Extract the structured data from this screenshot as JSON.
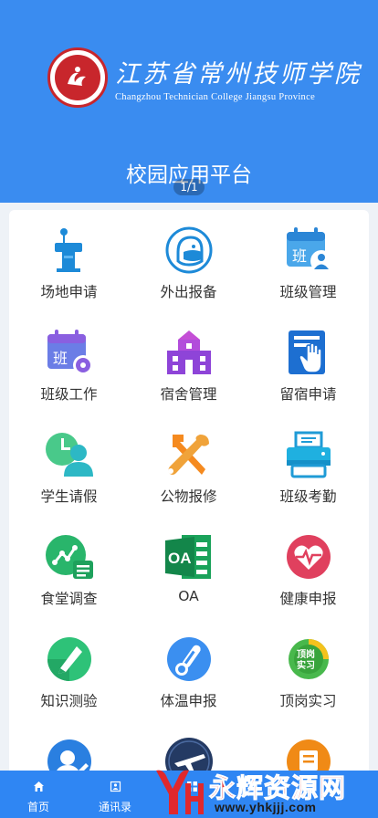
{
  "header": {
    "school_name_cn": "江苏省常州技师学院",
    "school_name_en": "Changzhou Technician College Jiangsu Province",
    "platform_title": "校园应用平台",
    "page_indicator": "1/1",
    "bg_color": "#3a8cf0"
  },
  "apps": [
    {
      "label": "场地申请",
      "icon": "podium-icon"
    },
    {
      "label": "外出报备",
      "icon": "face-mask-icon"
    },
    {
      "label": "班级管理",
      "icon": "class-calendar-user-icon"
    },
    {
      "label": "班级工作",
      "icon": "class-calendar-gear-icon"
    },
    {
      "label": "宿舍管理",
      "icon": "dormitory-icon"
    },
    {
      "label": "留宿申请",
      "icon": "hand-document-icon"
    },
    {
      "label": "学生请假",
      "icon": "clock-person-icon"
    },
    {
      "label": "公物报修",
      "icon": "wrench-hammer-icon"
    },
    {
      "label": "班级考勤",
      "icon": "printer-icon"
    },
    {
      "label": "食堂调查",
      "icon": "survey-chart-icon"
    },
    {
      "label": "OA",
      "icon": "oa-icon"
    },
    {
      "label": "健康申报",
      "icon": "heart-pulse-icon"
    },
    {
      "label": "知识测验",
      "icon": "pen-check-icon"
    },
    {
      "label": "体温申报",
      "icon": "thermometer-icon"
    },
    {
      "label": "顶岗实习",
      "icon": "internship-badge-icon"
    },
    {
      "label": "",
      "icon": "person-edit-icon"
    },
    {
      "label": "",
      "icon": "airplane-circle-icon"
    },
    {
      "label": "",
      "icon": "orange-app-icon"
    }
  ],
  "bottom_nav": [
    {
      "label": "首页",
      "icon": "home-icon"
    },
    {
      "label": "通讯录",
      "icon": "contacts-icon"
    },
    {
      "label": "",
      "icon": "apps-icon"
    }
  ],
  "watermark": {
    "text": "永辉资源网",
    "url": "www.yhkjjj.com"
  }
}
